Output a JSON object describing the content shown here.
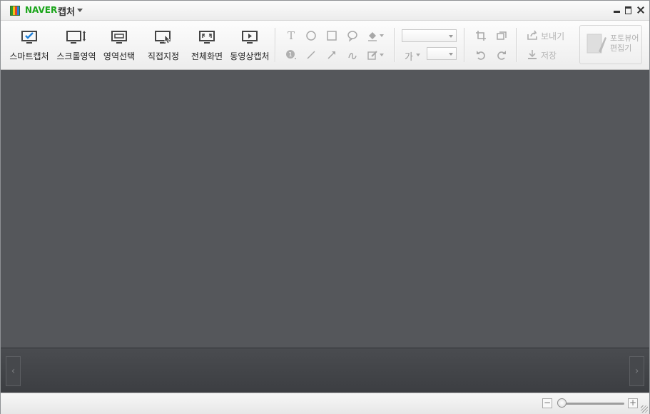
{
  "window": {
    "brand": "NAVER",
    "app_name": "캡처"
  },
  "capture_tools": [
    {
      "id": "smart",
      "label": "스마트캡처",
      "icon": "monitor-check-icon"
    },
    {
      "id": "scroll",
      "label": "스크롤영역",
      "icon": "monitor-scroll-icon"
    },
    {
      "id": "region",
      "label": "영역선택",
      "icon": "monitor-region-icon"
    },
    {
      "id": "manual",
      "label": "직접지정",
      "icon": "monitor-pointer-icon"
    },
    {
      "id": "fullscreen",
      "label": "전체화면",
      "icon": "monitor-fullscreen-icon"
    },
    {
      "id": "video",
      "label": "동영상캡처",
      "icon": "monitor-play-icon"
    }
  ],
  "drawing_tools": {
    "row1": [
      "text-tool-icon",
      "ellipse-tool-icon",
      "rectangle-tool-icon",
      "speech-bubble-icon",
      "fill-bucket-icon"
    ],
    "row2": [
      "number-stamp-icon",
      "line-tool-icon",
      "arrow-tool-icon",
      "freehand-icon",
      "pen-edit-icon"
    ],
    "text_tool_glyph": "T",
    "font_glyph": "가"
  },
  "actions": {
    "send_label": "보내기",
    "save_label": "저장"
  },
  "photo_editor": {
    "line1": "포토뷰어",
    "line2": "편집기"
  },
  "strip": {
    "left_arrow": "‹",
    "right_arrow": "›"
  },
  "zoom": {
    "minus": "−",
    "plus": "+",
    "level": 0.02
  },
  "colors": {
    "brand_green": "#1aa51a",
    "canvas_bg": "#55575b",
    "strip_bg": "#44464a"
  }
}
